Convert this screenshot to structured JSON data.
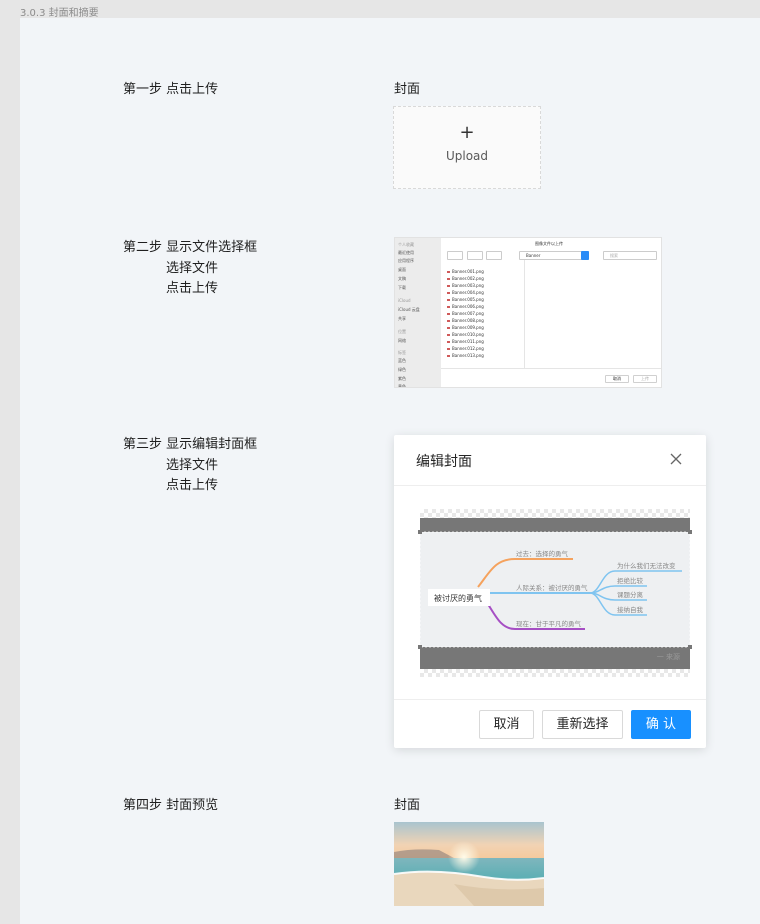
{
  "breadcrumb": "3.0.3 封面和摘要",
  "steps": {
    "step1": {
      "title": "第一步 点击上传",
      "field_label": "封面",
      "upload_label": "Upload"
    },
    "step2": {
      "title": "第二步 显示文件选择框",
      "lines": [
        "选择文件",
        "点击上传"
      ]
    },
    "step3": {
      "title": "第三步 显示编辑封面框",
      "lines": [
        "选择文件",
        "点击上传"
      ]
    },
    "step4": {
      "title": "第四步 封面预览",
      "field_label": "封面"
    }
  },
  "file_dialog": {
    "title": "图像文件以上传",
    "folder": "Banner",
    "search_placeholder": "搜索",
    "sidebar_sections": [
      "个人收藏",
      "iCloud",
      "位置",
      "标签"
    ],
    "sidebar_items": [
      "最近使用",
      "应用程序",
      "桌面",
      "文稿",
      "下载",
      "iCloud 云盘",
      "共享",
      "网络",
      "蓝色",
      "绿色",
      "紫色",
      "黄色"
    ],
    "files": [
      "Banner.001.png",
      "Banner.002.png",
      "Banner.003.png",
      "Banner.004.png",
      "Banner.005.png",
      "Banner.006.png",
      "Banner.007.png",
      "Banner.008.png",
      "Banner.009.png",
      "Banner.010.png",
      "Banner.011.png",
      "Banner.012.png",
      "Banner.013.png"
    ],
    "cancel": "取消",
    "upload": "上传"
  },
  "editor": {
    "title": "编辑封面",
    "cancel": "取消",
    "reselect": "重新选择",
    "confirm": "确 认",
    "mindmap": {
      "center": "被讨厌的勇气",
      "branches": [
        "过去：选择的勇气",
        "人际关系：被讨厌的勇气",
        "现在：甘于平凡的勇气"
      ],
      "leaves": [
        "为什么我们无法改变",
        "拒绝比较",
        "课题分离",
        "接纳自我"
      ],
      "watermark": "一 来源"
    }
  },
  "colors": {
    "primary": "#1890ff",
    "orange": "#f5a25d",
    "blue": "#7fc4f0",
    "purple": "#a64fc4"
  }
}
